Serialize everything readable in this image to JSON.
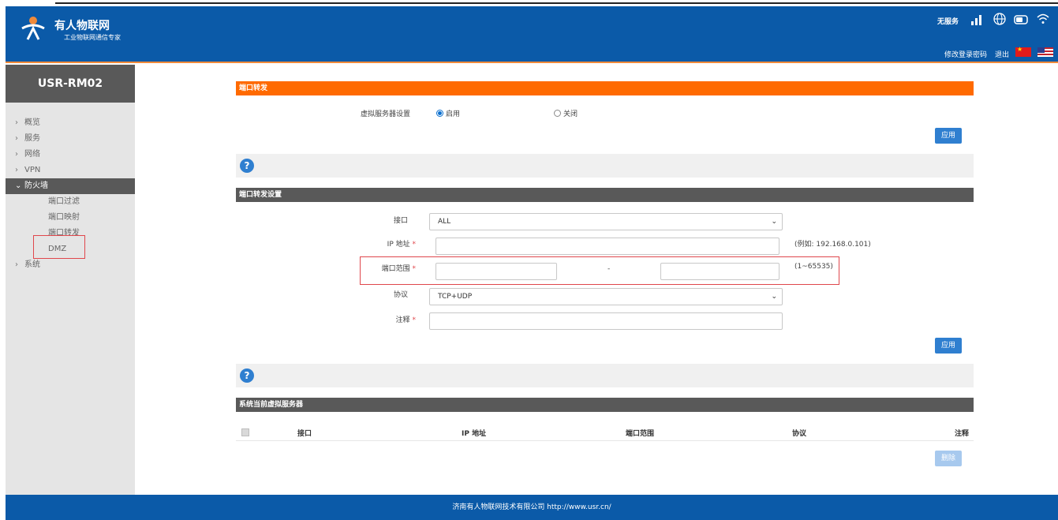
{
  "header": {
    "brand": "有人物联网",
    "slogan": "工业物联网通信专家",
    "service_status": "无服务",
    "change_password": "修改登录密码",
    "logout": "退出"
  },
  "sidebar": {
    "device": "USR-RM02",
    "items": [
      {
        "label": "概览"
      },
      {
        "label": "服务"
      },
      {
        "label": "网络"
      },
      {
        "label": "VPN"
      },
      {
        "label": "防火墙"
      }
    ],
    "firewall_sub": [
      {
        "label": "端口过滤"
      },
      {
        "label": "端口映射"
      },
      {
        "label": "端口转发"
      },
      {
        "label": "DMZ"
      }
    ],
    "system": {
      "label": "系统"
    }
  },
  "port_forward": {
    "title": "端口转发",
    "virtual_server_label": "虚拟服务器设置",
    "enable": "启用",
    "disable": "关闭",
    "apply": "应用"
  },
  "help": {
    "icon_text": "?"
  },
  "settings": {
    "title": "端口转发设置",
    "interface_label": "接口",
    "interface_value": "ALL",
    "ip_label": "IP 地址",
    "ip_hint": "(例如: 192.168.0.101)",
    "port_label": "端口范围",
    "port_sep": "-",
    "port_hint": "(1~65535)",
    "protocol_label": "协议",
    "protocol_value": "TCP+UDP",
    "comment_label": "注释",
    "required_mark": "*",
    "apply": "应用"
  },
  "current": {
    "title": "系统当前虚拟服务器",
    "columns": [
      "接口",
      "IP 地址",
      "端口范围",
      "协议",
      "注释"
    ],
    "delete": "删除"
  },
  "footer": {
    "text": "济南有人物联网技术有限公司 http://www.usr.cn/"
  },
  "colors": {
    "header_blue": "#0b5aa8",
    "accent_orange": "#ff6a00",
    "section_dark": "#595959",
    "button_blue": "#2f7fd0",
    "highlight_red": "#e0474c"
  }
}
